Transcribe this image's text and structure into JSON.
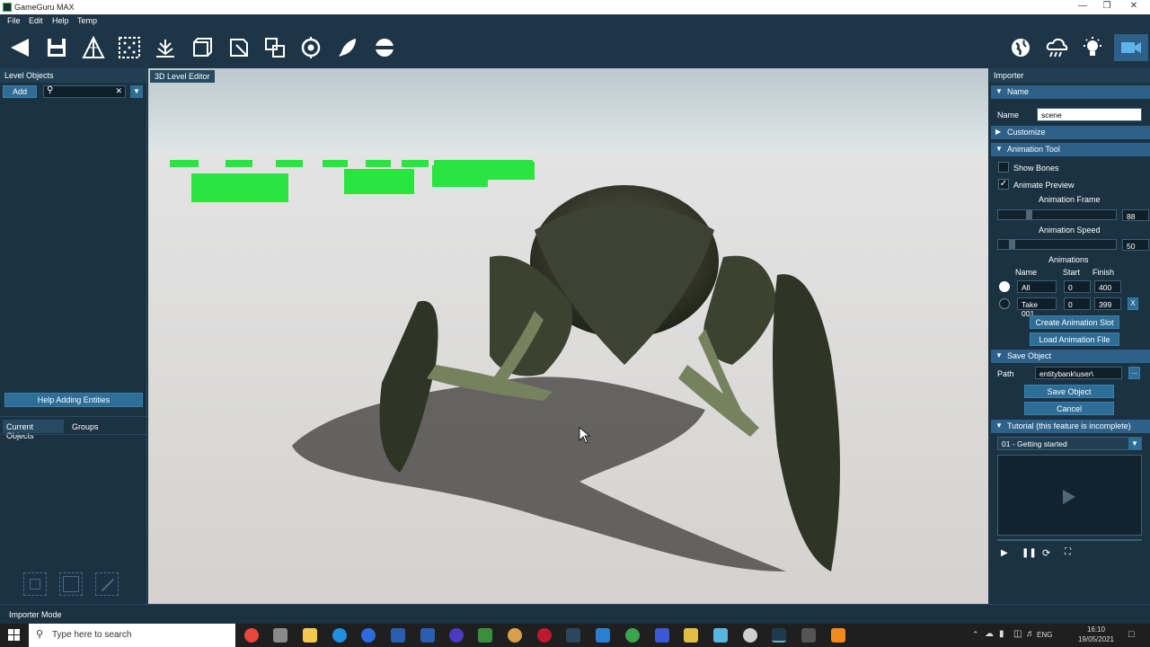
{
  "window": {
    "title": "GameGuru MAX"
  },
  "menu": [
    "File",
    "Edit",
    "Help",
    "Temp"
  ],
  "toolbar": {
    "left_tools": [
      "back-arrow-icon",
      "save-icon",
      "terrain-sculpt-icon",
      "terrain-paint-icon",
      "vegetation-icon",
      "add-object-icon",
      "markers-icon",
      "structure-editor-icon",
      "target-icon",
      "test-game-icon",
      "settings-icon"
    ],
    "right_tools": [
      "environment-icon",
      "weather-icon",
      "lighting-icon",
      "camera-icon"
    ]
  },
  "left_panel": {
    "header": "Level Objects",
    "add_label": "Add",
    "search_value": "",
    "help_button": "Help Adding Entities",
    "tabs": [
      "Current Objects",
      "Groups"
    ]
  },
  "viewport": {
    "tab_label": "3D Level Editor"
  },
  "importer": {
    "header": "Importer",
    "name_section": "Name",
    "name_label": "Name",
    "name_value": "scene",
    "customize_section": "Customize",
    "animation_section": "Animation Tool",
    "show_bones_label": "Show Bones",
    "show_bones_checked": false,
    "animate_preview_label": "Animate Preview",
    "animate_preview_checked": true,
    "animation_frame_label": "Animation Frame",
    "animation_frame_value": "88",
    "animation_frame_fraction": 0.25,
    "animation_speed_label": "Animation Speed",
    "animation_speed_value": "50",
    "animation_speed_fraction": 0.1,
    "animations_label": "Animations",
    "anim_cols": {
      "name": "Name",
      "start": "Start",
      "finish": "Finish"
    },
    "animations": [
      {
        "name": "All",
        "start": "0",
        "finish": "400",
        "selected": true
      },
      {
        "name": "Take 001",
        "start": "0",
        "finish": "399",
        "selected": false
      }
    ],
    "delete_label": "X",
    "create_slot_button": "Create Animation Slot",
    "load_file_button": "Load Animation File",
    "save_section": "Save Object",
    "path_label": "Path",
    "path_value": "entitybank\\user\\",
    "browse_label": "...",
    "save_button": "Save Object",
    "cancel_button": "Cancel",
    "tutorial_section": "Tutorial (this feature is incomplete)",
    "tutorial_selected": "01 - Getting started"
  },
  "status": {
    "mode": "Importer Mode"
  },
  "taskbar": {
    "search_placeholder": "Type here to search",
    "language": "ENG",
    "time": "16:10",
    "date": "19/05/2021"
  },
  "colors": {
    "accent": "#2d6189",
    "panel": "#1b3242",
    "button": "#2e6d96",
    "green_block": "#22e33a"
  }
}
